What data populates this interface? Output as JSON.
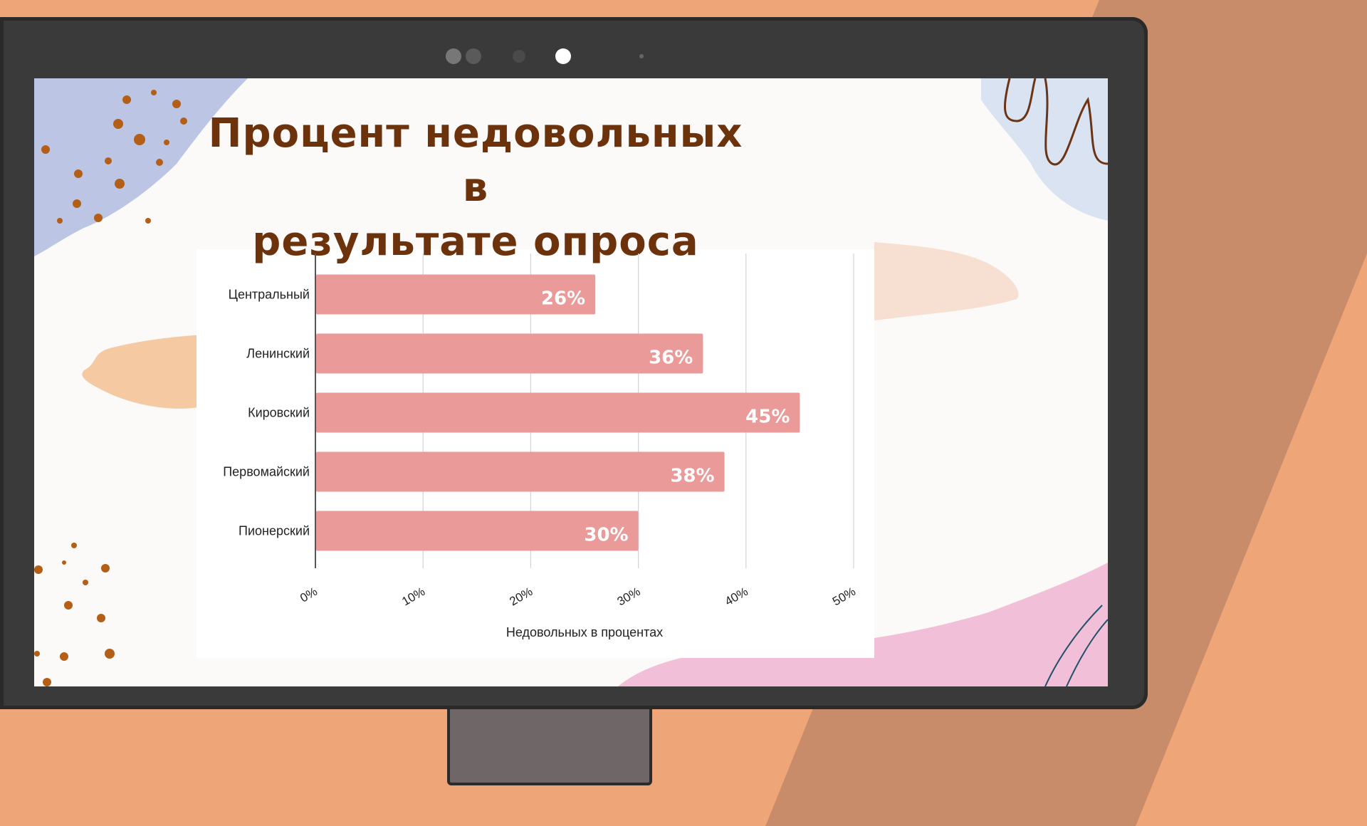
{
  "slide": {
    "title_line1": "Процент недовольных в",
    "title_line2": "результате опроса"
  },
  "colors": {
    "bar": "#e99a99",
    "title": "#6b320c",
    "grid": "#d4d4d4"
  },
  "chart_data": {
    "type": "bar",
    "orientation": "horizontal",
    "categories": [
      "Центральный",
      "Ленинский",
      "Кировский",
      "Первомайский",
      "Пионерский"
    ],
    "values": [
      26,
      36,
      45,
      38,
      30
    ],
    "value_labels": [
      "26%",
      "36%",
      "45%",
      "38%",
      "30%"
    ],
    "title": "",
    "xlabel": "Недовольных в процентах",
    "ylabel": "",
    "xlim": [
      0,
      50
    ],
    "xticks": [
      0,
      10,
      20,
      30,
      40,
      50
    ],
    "xtick_labels": [
      "0%",
      "10%",
      "20%",
      "30%",
      "40%",
      "50%"
    ],
    "grid": true,
    "legend": "none"
  }
}
